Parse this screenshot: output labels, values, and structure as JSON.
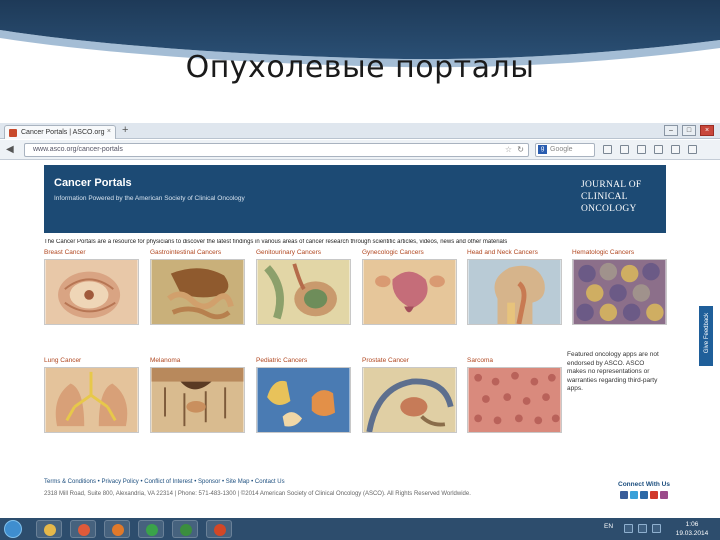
{
  "slide": {
    "title": "Опухолевые порталы"
  },
  "browser": {
    "tab_title": "Cancer Portals | ASCO.org",
    "tab_close": "×",
    "new_tab": "+",
    "window_buttons": [
      "–",
      "□",
      "×"
    ],
    "url": "www.asco.org/cancer-portals",
    "search_placeholder": "Google"
  },
  "page": {
    "header_title": "Cancer Portals",
    "header_subtitle": "Information Powered by the American Society of Clinical Oncology",
    "journal_logo": [
      "JOURNAL OF",
      "CLINICAL",
      "ONCOLOGY"
    ],
    "intro": "The Cancer Portals are a resource for physicians to discover the latest findings in various areas of cancer research through scientific articles, videos, news and other materials",
    "portals": [
      {
        "label": "Breast Cancer"
      },
      {
        "label": "Gastrointestinal Cancers"
      },
      {
        "label": "Genitourinary Cancers"
      },
      {
        "label": "Gynecologic Cancers"
      },
      {
        "label": "Head and Neck Cancers"
      },
      {
        "label": "Hematologic Cancers"
      },
      {
        "label": "Lung Cancer"
      },
      {
        "label": "Melanoma"
      },
      {
        "label": "Pediatric Cancers"
      },
      {
        "label": "Prostate Cancer"
      },
      {
        "label": "Sarcoma"
      }
    ],
    "disclaimer": "Featured oncology apps are not endorsed by ASCO. ASCO makes no representations or warranties regarding third-party apps.",
    "feedback": "Give Feedback",
    "footer_links": "Terms & Conditions • Privacy Policy • Conflict of Interest • Sponsor • Site Map • Contact Us",
    "copyright": "2318 Mill Road, Suite 800, Alexandria, VA 22314 | Phone: 571-483-1300 | ©2014 American Society of Clinical Oncology (ASCO). All Rights Reserved Worldwide.",
    "connect": "Connect With Us"
  },
  "taskbar": {
    "tray_lang": "EN",
    "time": "1:06",
    "date": "19.03.2014"
  }
}
